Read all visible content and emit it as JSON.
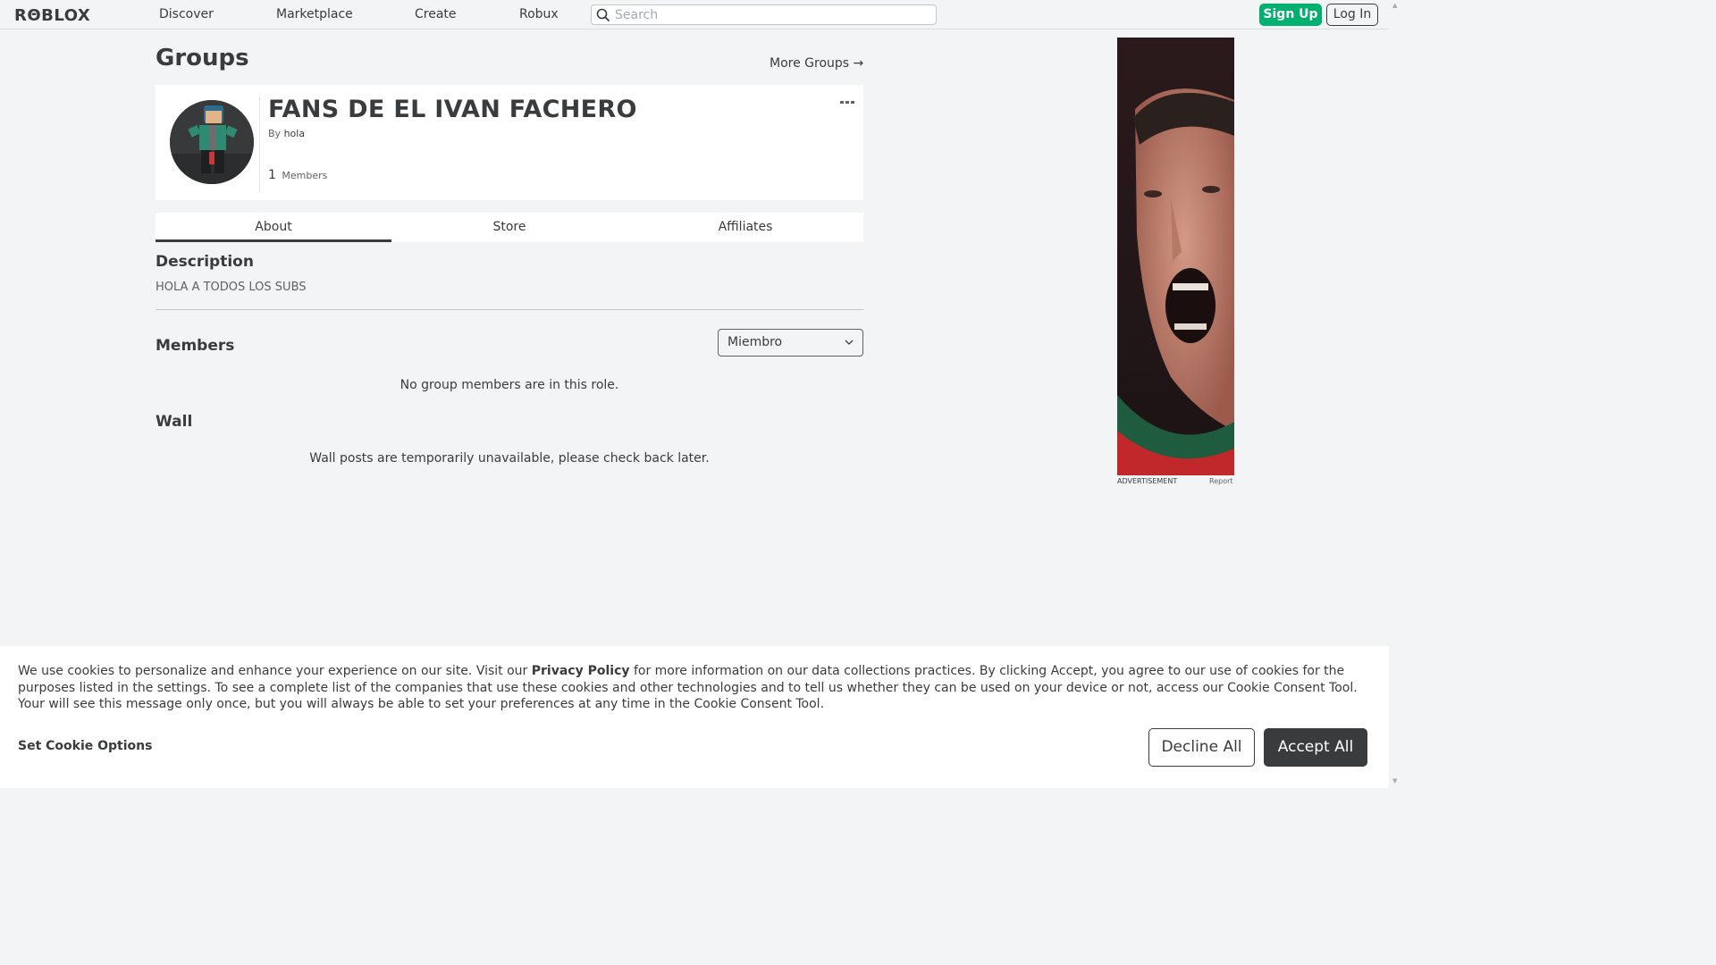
{
  "header": {
    "logo": "RΘBLOX",
    "nav": [
      "Discover",
      "Marketplace",
      "Create",
      "Robux"
    ],
    "search_placeholder": "Search",
    "signup": "Sign Up",
    "login": "Log In"
  },
  "page": {
    "title": "Groups",
    "more_groups": "More Groups →"
  },
  "group": {
    "name": "FANS DE EL IVAN FACHERO",
    "by_prefix": "By",
    "owner": "hola",
    "member_count": "1",
    "members_label": "Members",
    "menu_icon": "more-dots-icon"
  },
  "tabs": [
    "About",
    "Store",
    "Affiliates"
  ],
  "about": {
    "description_heading": "Description",
    "description": "HOLA A TODOS LOS SUBS",
    "members_heading": "Members",
    "role_selected": "Miembro",
    "no_members": "No group members are in this role.",
    "wall_heading": "Wall",
    "wall_message": "Wall posts are temporarily unavailable, please check back later."
  },
  "ad": {
    "label": "ADVERTISEMENT",
    "report": "Report"
  },
  "cookie": {
    "text_before": "We use cookies to personalize and enhance your experience on our site. Visit our ",
    "link": "Privacy Policy",
    "text_after": " for more information on our data collections practices. By clicking Accept, you agree to our use of cookies for the purposes listed in the settings. To see a complete list of the companies that use these cookies and other technologies and to tell us whether they can be used on your device or not, access our Cookie Consent Tool. Your will see this message only once, but you will always be able to set your preferences at any time in the Cookie Consent Tool.",
    "options": "Set Cookie Options",
    "decline": "Decline All",
    "accept": "Accept All"
  },
  "colors": {
    "signup_green": "#00b06f",
    "text": "#393b3d",
    "background": "#f2f4f5"
  }
}
